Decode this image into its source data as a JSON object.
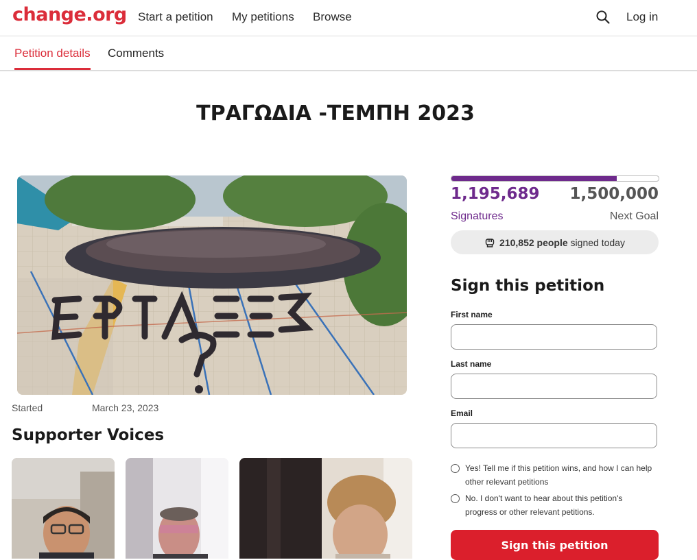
{
  "brand": {
    "logo": "change.org",
    "color": "#db2d3a"
  },
  "nav": {
    "items": [
      "Start a petition",
      "My petitions",
      "Browse"
    ],
    "login": "Log in",
    "search_icon": "search-icon"
  },
  "tabs": [
    {
      "label": "Petition details",
      "active": true
    },
    {
      "label": "Comments",
      "active": false
    }
  ],
  "petition": {
    "title": "ΤΡΑΓΩΔΙΑ -ΤΕΜΠΗ 2023",
    "started_label": "Started",
    "started_date": "March 23, 2023",
    "image_icon": "photo-of-students-spelling-text"
  },
  "supporter_voices": {
    "title": "Supporter Voices",
    "items": [
      "supporter-video-1",
      "supporter-video-2",
      "supporter-video-3"
    ]
  },
  "stats": {
    "signatures": "1,195,689",
    "signatures_label": "Signatures",
    "goal": "1,500,000",
    "goal_label": "Next Goal",
    "progress_fraction": 0.797,
    "today_count": "210,852 people",
    "today_suffix": "signed today",
    "accent": "#6e2a8c"
  },
  "form": {
    "title": "Sign this petition",
    "first_name_label": "First name",
    "last_name_label": "Last name",
    "email_label": "Email",
    "first_name_value": "",
    "last_name_value": "",
    "email_value": "",
    "option_yes": "Yes! Tell me if this petition wins, and how I can help other relevant petitions",
    "option_no": "No. I don't want to hear about this petition's progress or other relevant petitions.",
    "submit_label": "Sign this petition",
    "button_color": "#db1f2c"
  }
}
